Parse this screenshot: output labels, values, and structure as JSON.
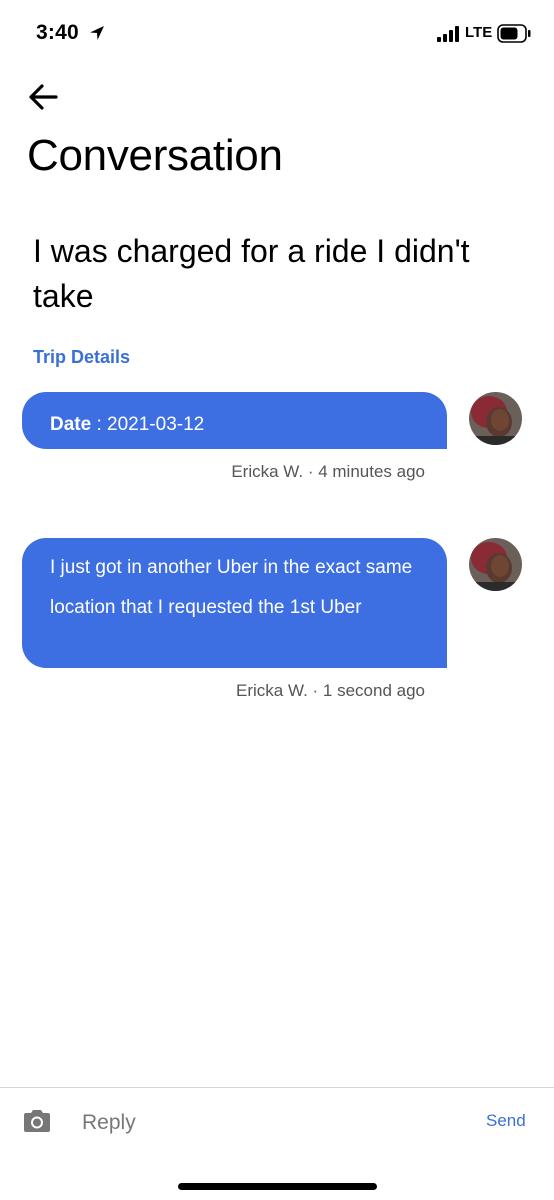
{
  "status_bar": {
    "time": "3:40",
    "network": "LTE"
  },
  "header": {
    "title": "Conversation"
  },
  "conversation": {
    "subject": "I was charged for a ride I didn't take",
    "trip_details_label": "Trip Details"
  },
  "messages": [
    {
      "label": "Date",
      "separator": " : ",
      "value": "2021-03-12",
      "meta": "Ericka W. · 4 minutes ago",
      "avatar": "user-avatar-photo"
    },
    {
      "text": "I just got in another Uber in the exact same location that I requested the 1st Uber",
      "meta": "Ericka W. · 1 second ago",
      "avatar": "user-avatar-photo"
    }
  ],
  "composer": {
    "placeholder": "Reply",
    "value": "",
    "send_label": "Send",
    "camera_icon": "camera-icon"
  },
  "colors": {
    "bubble": "#3d6fe3",
    "link": "#3b6fd8",
    "meta_text": "#555555"
  }
}
